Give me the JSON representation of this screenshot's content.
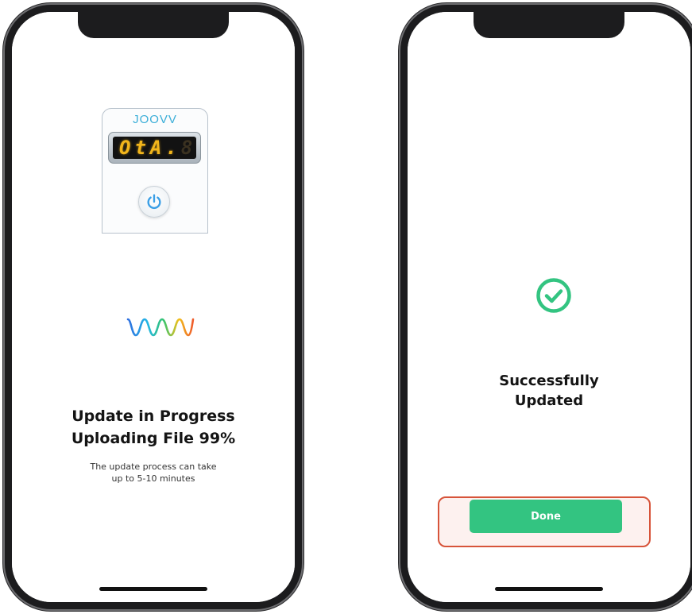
{
  "progress_screen": {
    "device": {
      "brand": "JOOVV",
      "display_text": "OtA.",
      "display_ghost": "8"
    },
    "icons": {
      "wave": "joovv-wave-logo-icon",
      "power": "power-icon"
    },
    "title_line1": "Update in Progress",
    "title_line2": "Uploading File 99%",
    "upload_progress_percent": 99,
    "subtitle_line1": "The update process can take",
    "subtitle_line2": "up to 5-10 minutes"
  },
  "success_screen": {
    "icons": {
      "check": "check-circle-icon"
    },
    "title_line1": "Successfully",
    "title_line2": "Updated",
    "done_label": "Done"
  },
  "colors": {
    "accent_green": "#33c481",
    "highlight_border": "#d7543a",
    "display_amber": "#f2b51b",
    "brand_blue": "#3aaed8"
  }
}
